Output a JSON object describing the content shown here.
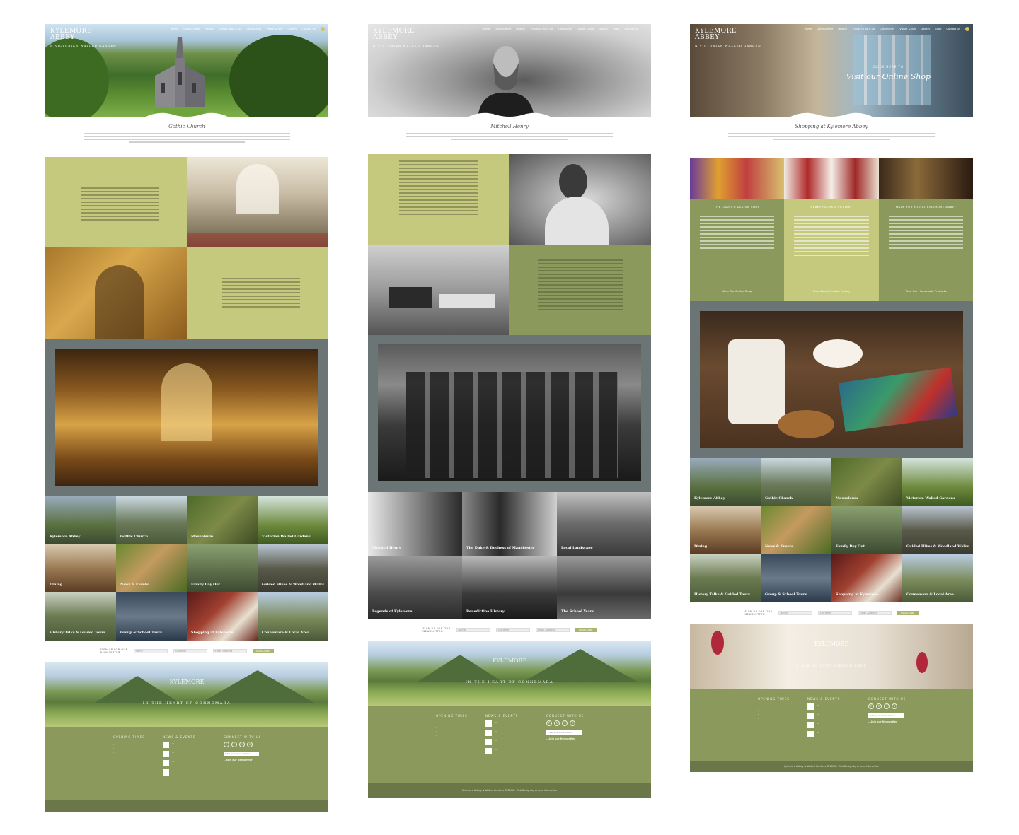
{
  "brand": {
    "logo_line1": "KYLEMORE",
    "logo_line2": "ABBEY",
    "logo_sub": "& VICTORIAN WALLED GARDEN"
  },
  "nav": [
    "Home",
    "Getting Here",
    "History",
    "Things to do & Do",
    "Community",
    "Visitor & Info",
    "Gallery",
    "Shop",
    "Contact Us"
  ],
  "page1": {
    "intro_title": "Gothic Church",
    "tiles": [
      "Kylemore Abbey",
      "Gothic Church",
      "Mausoleum",
      "Victorian Walled Gardens",
      "Dining",
      "News & Events",
      "Family Day Out",
      "Guided Hikes & Woodland Walks",
      "History Talks & Guided Tours",
      "Group & School Tours",
      "Shopping at Kylemore",
      "Connemara & Local Area"
    ]
  },
  "page2": {
    "intro_title": "Mitchell Henry",
    "tiles": [
      "Mitchell Henry",
      "The Duke & Duchess of Manchester",
      "Local Landscape",
      "Legends of Kylemore",
      "Benedictine History",
      "The School Years"
    ]
  },
  "page3": {
    "hero_kicker": "CLICK HERE TO",
    "hero_cta": "Visit our Online Shop",
    "intro_title": "Shopping at Kylemore Abbey",
    "cards": [
      {
        "heading": "THE CRAFT & DESIGN SHOP",
        "link": "View Our Online Shop"
      },
      {
        "heading": "ABBEY FUCHSIA POTTERY",
        "link": "View Abbey Fuchsia Pottery"
      },
      {
        "heading": "MADE FOR YOU AT KYLEMORE ABBEY",
        "link": "View Our Homemade Products"
      }
    ],
    "tiles": [
      "Kylemore Abbey",
      "Gothic Church",
      "Mausoleum",
      "Victorian Walled Gardens",
      "Dining",
      "News & Events",
      "Family Day Out",
      "Guided Hikes & Woodland Walks",
      "History Talks & Guided Tours",
      "Group & School Tours",
      "Shopping at Kylemore",
      "Connemara & Local Area"
    ],
    "shop_banner": "CLICK TO VISIT ONLINE SHOP"
  },
  "newsletter": {
    "label_1": "SIGN UP FOR OUR",
    "label_2": "NEWSLETTER",
    "name": "Name",
    "surname": "Surname",
    "email": "Email Address",
    "button": "SUBSCRIBE"
  },
  "landscape_tag": "IN THE HEART OF CONNEMARA",
  "footer": {
    "opening_heading": "OPENING TIMES",
    "news_heading": "NEWS & EVENTS",
    "connect_heading": "CONNECT WITH US",
    "email_placeholder": "Enter your email address",
    "join": "...Join our Newsletter",
    "copyright": "Kylemore Abbey & Walled Gardens © 2016 - Web Design by Arrows Interactive"
  },
  "colors": {
    "olive": "#c4c97e",
    "sage": "#8b9a5c",
    "slate": "#6c7576",
    "footer_bar": "#6b7649"
  }
}
